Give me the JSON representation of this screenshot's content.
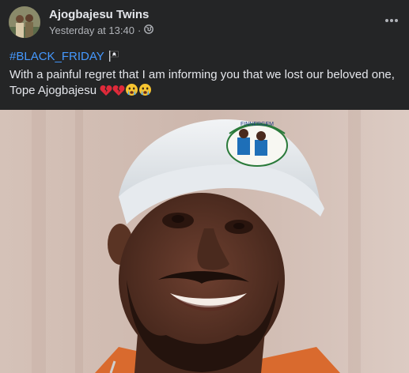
{
  "post": {
    "author": "Ajogbajesu Twins",
    "timestamp": "Yesterday at 13:40",
    "separator": "·",
    "privacy_icon": "globe-icon",
    "more_icon": "more-dots-icon",
    "hashtag": "#BLACK_FRIDAY",
    "text": "With a painful regret that I am informing you that we lost our beloved one, Tope Ajogbajesu",
    "emojis": [
      "broken-heart",
      "broken-heart",
      "crying-face",
      "crying-face"
    ],
    "cap_text": "FINNERGEM"
  },
  "colors": {
    "background": "#242526",
    "text": "#e4e6eb",
    "secondary": "#b0b3b8",
    "link": "#4599ff"
  }
}
